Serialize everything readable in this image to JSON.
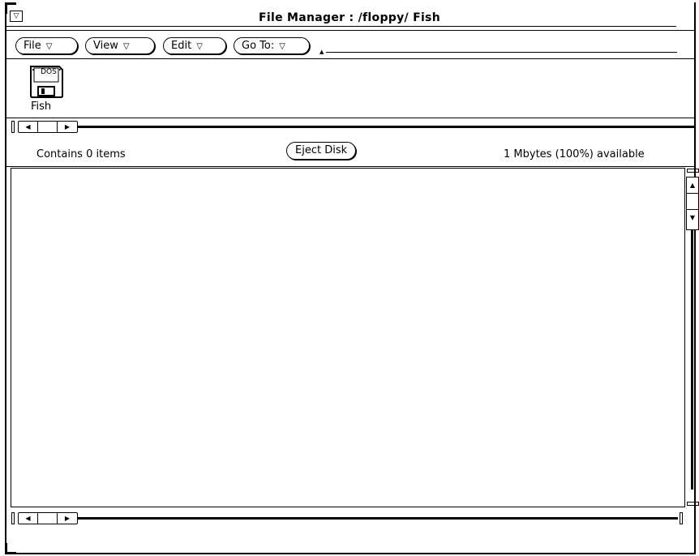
{
  "window": {
    "title": "File Manager : /floppy/ Fish",
    "menu_glyph": "▽"
  },
  "menubar": {
    "items": [
      {
        "label": "File",
        "tri": "▽"
      },
      {
        "label": "View",
        "tri": "▽"
      },
      {
        "label": "Edit",
        "tri": "▽"
      },
      {
        "label": "Go To:",
        "tri": "▽"
      }
    ],
    "goto_value": ""
  },
  "path_icon": {
    "badge": "DOS",
    "label": "Fish"
  },
  "status": {
    "left": "Contains 0 items",
    "button": "Eject Disk",
    "right": "1 Mbytes (100%) available"
  },
  "scroll_glyphs": {
    "left": "◀",
    "right": "▶",
    "up": "▲",
    "down": "▼"
  }
}
